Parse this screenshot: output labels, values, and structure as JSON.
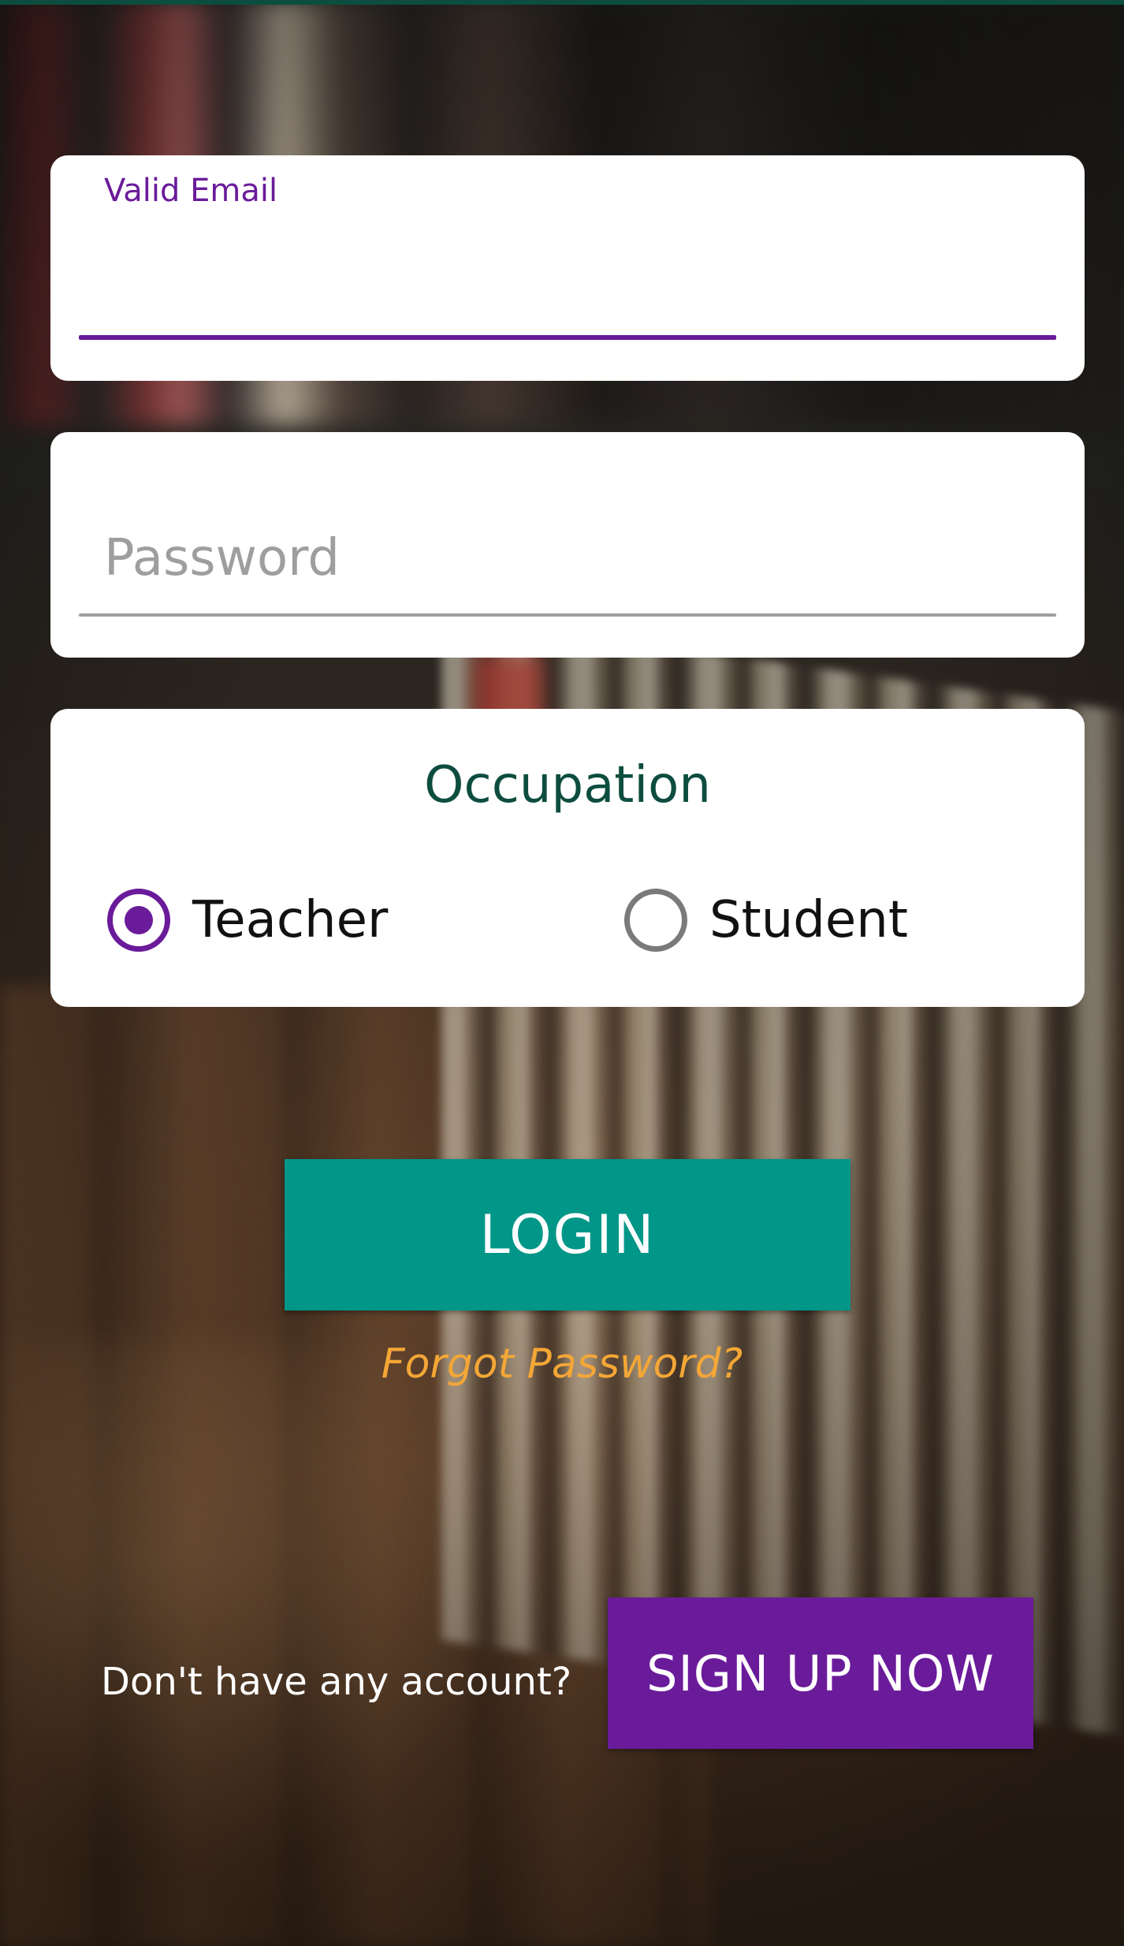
{
  "email": {
    "label": "Valid Email",
    "value": ""
  },
  "password": {
    "placeholder": "Password",
    "value": ""
  },
  "occupation": {
    "title": "Occupation",
    "options": [
      {
        "label": "Teacher",
        "selected": true
      },
      {
        "label": "Student",
        "selected": false
      }
    ]
  },
  "actions": {
    "login_label": "LOGIN",
    "forgot_label": "Forgot Password?",
    "signup_prompt": "Don't have any account?",
    "signup_label": "SIGN UP NOW"
  },
  "colors": {
    "primary": "#6a1b9a",
    "login_button": "#009688",
    "forgot_link": "#f4a736",
    "occupation_title": "#0d4d3f"
  }
}
